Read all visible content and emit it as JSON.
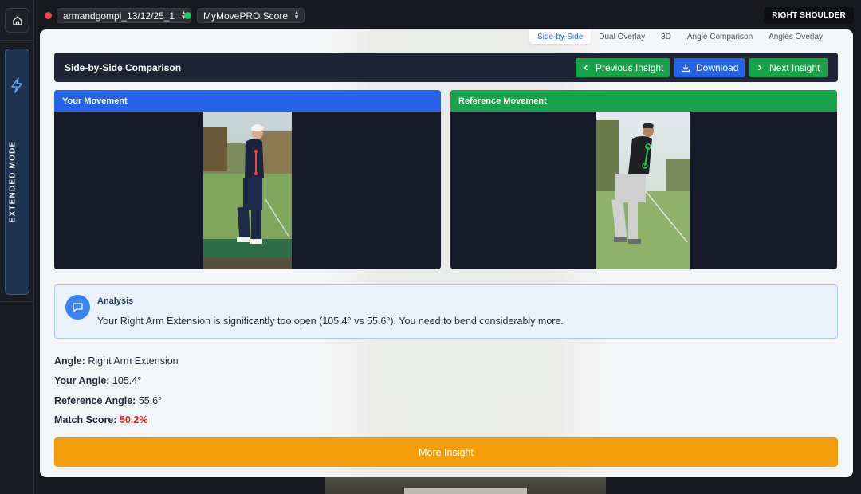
{
  "session": {
    "name": "armandgompi_13/12/25_1",
    "status_color": "#ef4444"
  },
  "profile": {
    "name": "MyMovePRO Score",
    "status_color": "#22c55e"
  },
  "badge": "RIGHT SHOULDER",
  "sidebar": {
    "extended_mode": "EXTENDED MODE"
  },
  "tabs": [
    {
      "label": "Side-by-Side",
      "active": true
    },
    {
      "label": "Dual Overlay"
    },
    {
      "label": "3D"
    },
    {
      "label": "Angle Comparison"
    },
    {
      "label": "Angles Overlay"
    }
  ],
  "header": {
    "title": "Side-by-Side Comparison",
    "prev": "Previous Insight",
    "download": "Download",
    "next": "Next Insight"
  },
  "panels": {
    "left": {
      "title": "Your Movement",
      "color": "#2563eb"
    },
    "right": {
      "title": "Reference Movement",
      "color": "#16a34a"
    }
  },
  "analysis": {
    "title": "Analysis",
    "text": "Your Right Arm Extension is significantly too open (105.4° vs 55.6°). You need to bend considerably more."
  },
  "stats": {
    "angle_label": "Angle:",
    "angle_value": "Right Arm Extension",
    "your_label": "Your Angle:",
    "your_value": "105.4°",
    "ref_label": "Reference Angle:",
    "ref_value": "55.6°",
    "score_label": "Match Score:",
    "score_value": "50.2%"
  },
  "more_button": "More Insight"
}
